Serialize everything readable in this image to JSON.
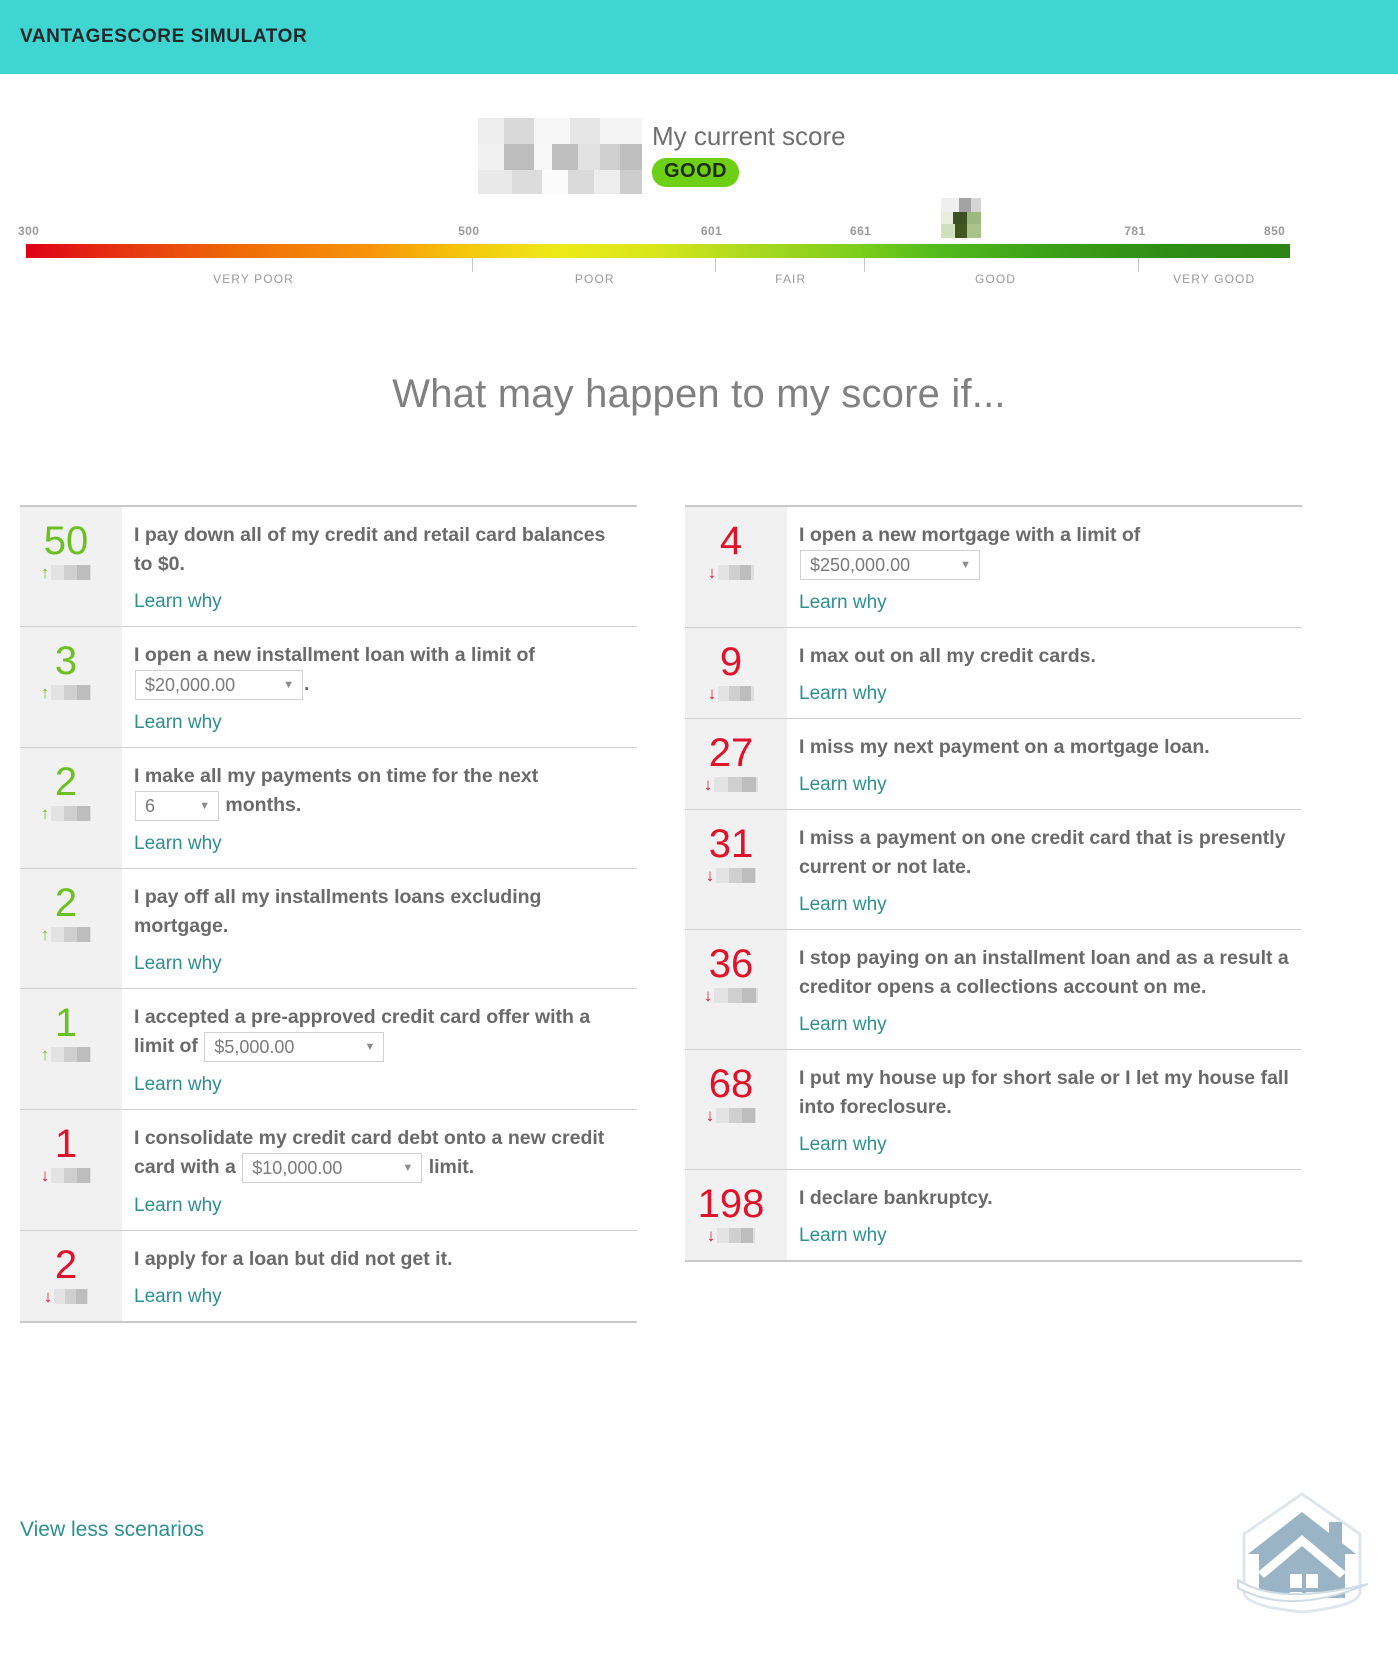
{
  "header": {
    "title": "VantageScore Simulator"
  },
  "current_score": {
    "label": "My current score",
    "band": "GOOD",
    "value_redacted": true
  },
  "gauge": {
    "ticks": [
      {
        "value": "300",
        "pct": 0
      },
      {
        "value": "500",
        "pct": 35.3
      },
      {
        "value": "601",
        "pct": 54.5
      },
      {
        "value": "661",
        "pct": 66.3
      },
      {
        "value": "781",
        "pct": 88.0
      },
      {
        "value": "850",
        "pct": 100
      }
    ],
    "categories": [
      {
        "label": "VERY POOR",
        "pct": 18
      },
      {
        "label": "POOR",
        "pct": 45
      },
      {
        "label": "FAIR",
        "pct": 60.5
      },
      {
        "label": "GOOD",
        "pct": 76.7
      },
      {
        "label": "VERY GOOD",
        "pct": 94
      }
    ],
    "marker_pct": 74.0,
    "marker_redacted": true,
    "colors": {
      "low": "#e00016",
      "mid": "#eeea18",
      "high": "#2d8414"
    }
  },
  "section": {
    "heading": "What may happen to my score if..."
  },
  "labels": {
    "learn_why": "Learn why",
    "view_less": "View less scenarios"
  },
  "colors": {
    "accent": "#3fd6d2",
    "link": "#2c8f92",
    "positive": "#6cbf21",
    "negative": "#e0122a",
    "band": "#6ed015"
  },
  "scenarios": {
    "left": [
      {
        "delta": "50",
        "direction": "up",
        "redacted_width": 40,
        "parts": [
          {
            "type": "text",
            "value": "I pay down all of my credit and retail card balances to $0."
          }
        ]
      },
      {
        "delta": "3",
        "direction": "up",
        "redacted_width": 40,
        "parts": [
          {
            "type": "text",
            "value": "I open a new installment loan with a limit of "
          },
          {
            "type": "select",
            "value": "$20,000.00",
            "size": "wide"
          },
          {
            "type": "text",
            "value": "."
          }
        ]
      },
      {
        "delta": "2",
        "direction": "up",
        "redacted_width": 40,
        "parts": [
          {
            "type": "text",
            "value": "I make all my payments on time for the next "
          },
          {
            "type": "select",
            "value": "6",
            "size": "narrow"
          },
          {
            "type": "text",
            "value": " months."
          }
        ]
      },
      {
        "delta": "2",
        "direction": "up",
        "redacted_width": 40,
        "parts": [
          {
            "type": "text",
            "value": "I pay off all my installments loans excluding mortgage."
          }
        ]
      },
      {
        "delta": "1",
        "direction": "up",
        "redacted_width": 40,
        "parts": [
          {
            "type": "text",
            "value": "I accepted a pre-approved credit card offer with a limit of "
          },
          {
            "type": "select",
            "value": "$5,000.00",
            "size": "xwide"
          }
        ]
      },
      {
        "delta": "1",
        "direction": "down",
        "redacted_width": 40,
        "parts": [
          {
            "type": "text",
            "value": "I consolidate my credit card debt onto a new credit card with a "
          },
          {
            "type": "select",
            "value": "$10,000.00",
            "size": "xwide"
          },
          {
            "type": "text",
            "value": " limit."
          }
        ]
      },
      {
        "delta": "2",
        "direction": "down",
        "redacted_width": 34,
        "parts": [
          {
            "type": "text",
            "value": "I apply for a loan but did not get it."
          }
        ]
      }
    ],
    "right": [
      {
        "delta": "4",
        "direction": "down",
        "redacted_width": 36,
        "parts": [
          {
            "type": "text",
            "value": "I open a new mortgage with a limit of "
          },
          {
            "type": "select",
            "value": "$250,000.00",
            "size": "xwide"
          }
        ]
      },
      {
        "delta": "9",
        "direction": "down",
        "redacted_width": 36,
        "parts": [
          {
            "type": "text",
            "value": "I max out on all my credit cards."
          }
        ]
      },
      {
        "delta": "27",
        "direction": "down",
        "redacted_width": 44,
        "parts": [
          {
            "type": "text",
            "value": "I miss my next payment on a mortgage loan."
          }
        ]
      },
      {
        "delta": "31",
        "direction": "down",
        "redacted_width": 40,
        "parts": [
          {
            "type": "text",
            "value": "I miss a payment on one credit card that is presently current or not late."
          }
        ]
      },
      {
        "delta": "36",
        "direction": "down",
        "redacted_width": 44,
        "parts": [
          {
            "type": "text",
            "value": "I stop paying on an installment loan and as a result a creditor opens a collections account on me."
          }
        ]
      },
      {
        "delta": "68",
        "direction": "down",
        "redacted_width": 40,
        "parts": [
          {
            "type": "text",
            "value": "I put my house up for short sale or I let my house fall into foreclosure."
          }
        ]
      },
      {
        "delta": "198",
        "direction": "down",
        "redacted_width": 38,
        "parts": [
          {
            "type": "text",
            "value": "I declare bankruptcy."
          }
        ]
      }
    ]
  }
}
